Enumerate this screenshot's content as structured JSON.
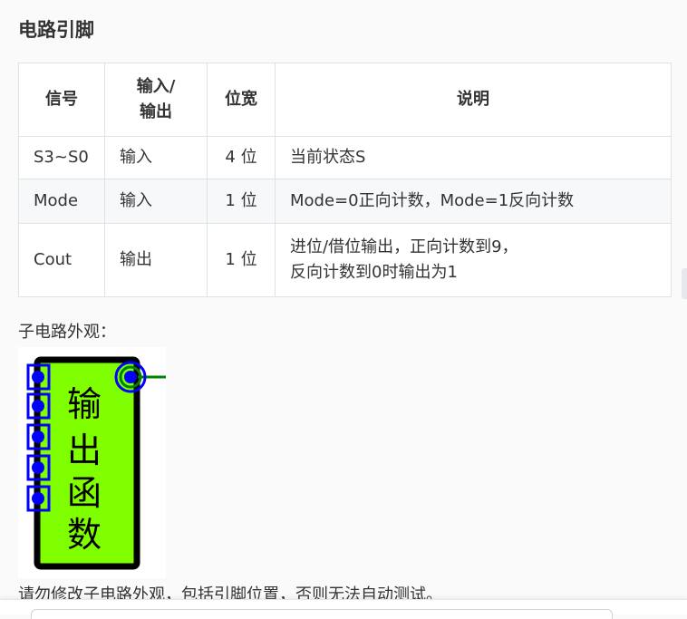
{
  "section": {
    "title": "电路引脚"
  },
  "table": {
    "headers": {
      "signal": "信号",
      "io_line1": "输入/",
      "io_line2": "输出",
      "width": "位宽",
      "desc": "说明"
    },
    "rows": [
      {
        "signal": "S3~S0",
        "io": "输入",
        "width": "4 位",
        "desc_line1": "当前状态S",
        "desc_line2": ""
      },
      {
        "signal": "Mode",
        "io": "输入",
        "width": "1 位",
        "desc_line1": "Mode=0正向计数，Mode=1反向计数",
        "desc_line2": ""
      },
      {
        "signal": "Cout",
        "io": "输出",
        "width": "1 位",
        "desc_line1": "进位/借位输出，正向计数到9，",
        "desc_line2": "反向计数到0时输出为1"
      }
    ]
  },
  "appearance": {
    "label": "子电路外观：",
    "circuit": {
      "label_chars": [
        "输",
        "出",
        "函",
        "数"
      ],
      "body_color": "#80ff00",
      "outline_color": "#000000",
      "pin_color": "#0000ff",
      "output_wire_color": "#008000"
    }
  },
  "warning": "请勿修改子电路外观，包括引脚位置，否则无法自动测试。"
}
